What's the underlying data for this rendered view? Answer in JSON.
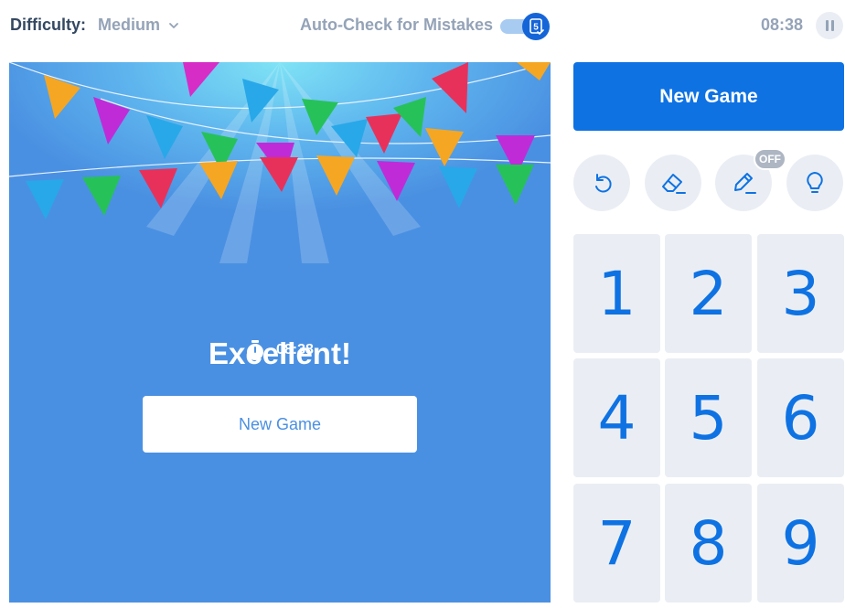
{
  "topbar": {
    "difficulty_label": "Difficulty:",
    "difficulty_value": "Medium",
    "autocheck_label": "Auto-Check for Mistakes",
    "autocheck_enabled": true,
    "timer": "08:38"
  },
  "win": {
    "title": "Excellent!",
    "time": "08:38",
    "button_label": "New Game"
  },
  "controls": {
    "new_game_label": "New Game",
    "tools": [
      {
        "name": "undo-icon"
      },
      {
        "name": "eraser-icon"
      },
      {
        "name": "pencil-icon",
        "badge": "OFF"
      },
      {
        "name": "hint-icon"
      }
    ],
    "numbers": [
      "1",
      "2",
      "3",
      "4",
      "5",
      "6",
      "7",
      "8",
      "9"
    ]
  },
  "colors": {
    "accent": "#0e72e3",
    "board": "#4a90e2",
    "muted": "#94a3b7",
    "tool_bg": "#eaeef4"
  }
}
